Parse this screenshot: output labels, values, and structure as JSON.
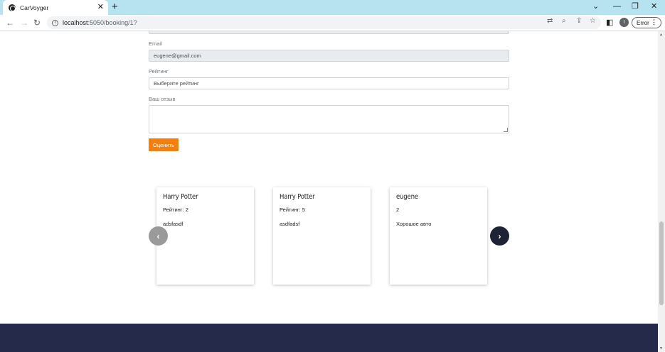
{
  "browser": {
    "tab_title": "CarVoyger",
    "tab_close": "✕",
    "new_tab": "+",
    "url_host": "localhost",
    "url_path": ":5050/booking/1?",
    "profile_initial": "I",
    "error_label": "Error",
    "icons": [
      "back-arrow-icon",
      "forward-arrow-icon",
      "reload-icon",
      "translate-icon",
      "zoom-icon",
      "share-icon",
      "star-icon",
      "sidebar-icon"
    ]
  },
  "form": {
    "email_label": "Email",
    "email_value": "eugene@gmail.com",
    "rating_label": "Рейтинг",
    "rating_placeholder": "Выберите рейтинг",
    "review_label": "Ваш отзыв",
    "submit_label": "Оценить",
    "submit_color": "#f57f0e"
  },
  "reviews": [
    {
      "name": "Harry Potter",
      "rating": "Рейтинг: 2",
      "text": "adsfasdf"
    },
    {
      "name": "Harry Potter",
      "rating": "Рейтинг: 5",
      "text": "asdfadsf"
    },
    {
      "name": "eugene",
      "rating": "2",
      "text": "Хорошое авто"
    }
  ],
  "carousel": {
    "prev_icon": "chevron-left-icon",
    "next_icon": "chevron-right-icon"
  },
  "footer_color": "#262a4a"
}
